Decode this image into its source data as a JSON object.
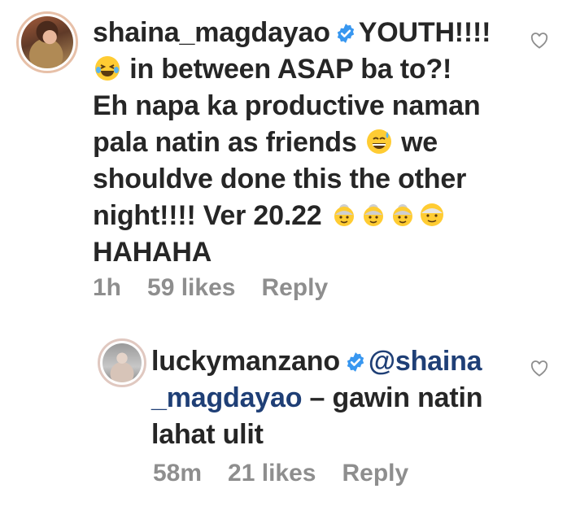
{
  "comment1": {
    "username": "shaina_magdayao",
    "text_line1": "YOUTH!!!!",
    "text_line2": "in between ASAP ba to?!",
    "text_line3": "Eh napa ka productive naman",
    "text_line4a": "pala natin as friends",
    "text_line4b": "we",
    "text_line5": "shouldve done this the other",
    "text_line6": "night!!!! Ver 20.22",
    "text_line7": "HAHAHA",
    "time": "1h",
    "likes": "59 likes",
    "reply_label": "Reply",
    "emojis": [
      "laughing-tears",
      "sweat-smile",
      "older-woman",
      "older-woman",
      "older-woman",
      "older-person"
    ]
  },
  "comment2": {
    "username": "luckymanzano",
    "mention_part1": "@shaina",
    "mention_part2": "_magdayao",
    "text_part1": "– gawin natin",
    "text_line3": "lahat ulit",
    "time": "58m",
    "likes": "21 likes",
    "reply_label": "Reply"
  },
  "colors": {
    "text": "#262626",
    "meta": "#8e8e8e",
    "mention": "#1f3f76",
    "verified": "#3897f0"
  }
}
